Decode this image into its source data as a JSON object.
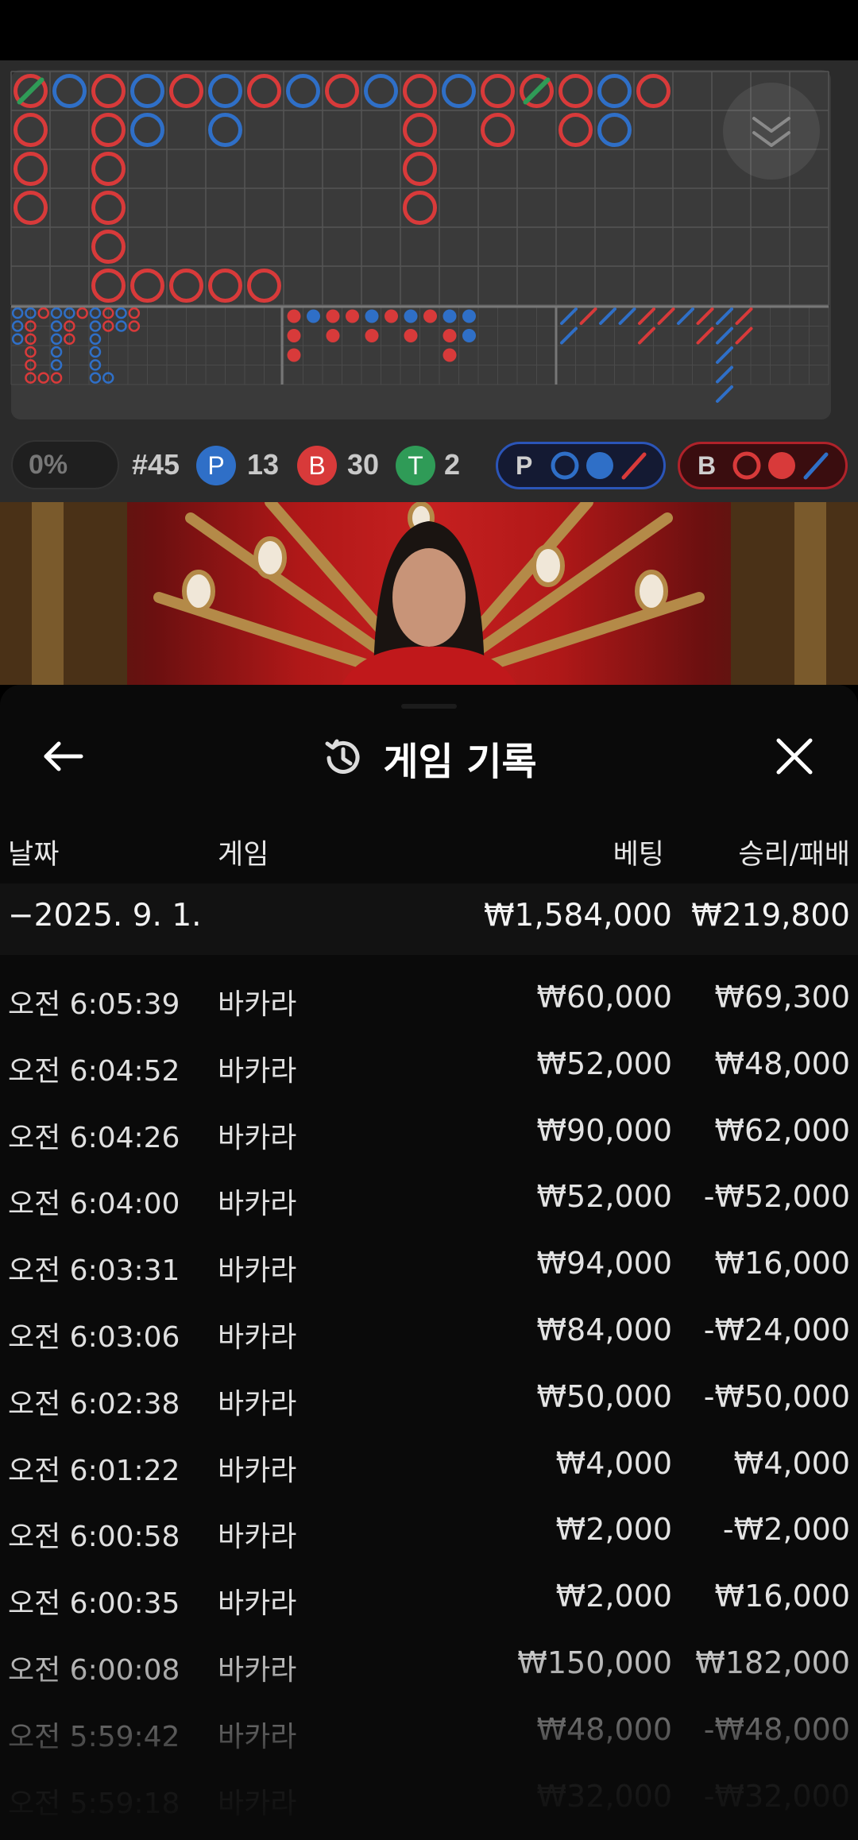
{
  "scoreboard": {
    "win_rate": "0%",
    "round_label": "#45",
    "player_badge": "P",
    "player_count": "13",
    "banker_badge": "B",
    "banker_count": "30",
    "tie_badge": "T",
    "tie_count": "2",
    "player_predict_label": "P",
    "banker_predict_label": "B",
    "colors": {
      "player": "#2f6fc7",
      "banker": "#d83a3a",
      "tie": "#2f9b57",
      "board_bg": "#2b2b2b"
    }
  },
  "sheet": {
    "title": "게임 기록",
    "headers": {
      "date": "날짜",
      "game": "게임",
      "bet": "베팅",
      "result": "승리/패배"
    },
    "summary": {
      "date": "−2025. 9. 1.",
      "bet": "₩1,584,000",
      "result": "₩219,800"
    },
    "rows": [
      {
        "time": "오전 6:05:39",
        "game": "바카라",
        "bet": "₩60,000",
        "result": "₩69,300"
      },
      {
        "time": "오전 6:04:52",
        "game": "바카라",
        "bet": "₩52,000",
        "result": "₩48,000"
      },
      {
        "time": "오전 6:04:26",
        "game": "바카라",
        "bet": "₩90,000",
        "result": "₩62,000"
      },
      {
        "time": "오전 6:04:00",
        "game": "바카라",
        "bet": "₩52,000",
        "result": "-₩52,000"
      },
      {
        "time": "오전 6:03:31",
        "game": "바카라",
        "bet": "₩94,000",
        "result": "₩16,000"
      },
      {
        "time": "오전 6:03:06",
        "game": "바카라",
        "bet": "₩84,000",
        "result": "-₩24,000"
      },
      {
        "time": "오전 6:02:38",
        "game": "바카라",
        "bet": "₩50,000",
        "result": "-₩50,000"
      },
      {
        "time": "오전 6:01:22",
        "game": "바카라",
        "bet": "₩4,000",
        "result": "₩4,000"
      },
      {
        "time": "오전 6:00:58",
        "game": "바카라",
        "bet": "₩2,000",
        "result": "-₩2,000"
      },
      {
        "time": "오전 6:00:35",
        "game": "바카라",
        "bet": "₩2,000",
        "result": "₩16,000"
      },
      {
        "time": "오전 6:00:08",
        "game": "바카라",
        "bet": "₩150,000",
        "result": "₩182,000"
      },
      {
        "time": "오전 5:59:42",
        "game": "바카라",
        "bet": "₩48,000",
        "result": "-₩48,000"
      },
      {
        "time": "오전 5:59:18",
        "game": "바카라",
        "bet": "₩32,000",
        "result": "-₩32,000"
      }
    ],
    "icons": {
      "back": "arrow-left-icon",
      "close": "close-icon",
      "history": "history-icon"
    }
  }
}
